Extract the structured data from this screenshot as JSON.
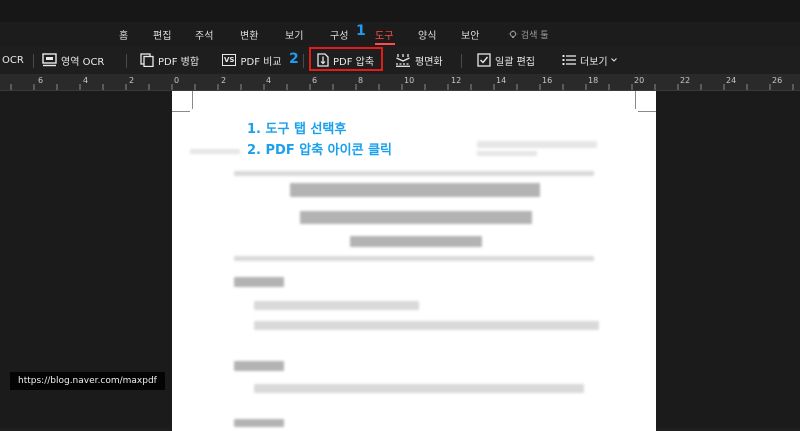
{
  "menu": {
    "tabs": [
      {
        "label": "홈"
      },
      {
        "label": "편집"
      },
      {
        "label": "주석"
      },
      {
        "label": "변환"
      },
      {
        "label": "보기"
      },
      {
        "label": "구성"
      },
      {
        "label": "도구",
        "active": true
      },
      {
        "label": "양식"
      },
      {
        "label": "보안"
      }
    ],
    "search_label": "검색 툴",
    "step1_badge": "1"
  },
  "toolbar": {
    "ocr_label": "OCR",
    "area_ocr_label": "영역 OCR",
    "merge_label": "PDF 병합",
    "compare_label": "PDF 비교",
    "compare_icon_text": "VS",
    "step2_badge": "2",
    "compress_label": "PDF 압축",
    "flatten_label": "평면화",
    "batch_label": "일괄 편집",
    "more_label": "더보기"
  },
  "ruler": {
    "labels": [
      "6",
      "4",
      "2",
      "0",
      "2",
      "4",
      "6",
      "8",
      "10",
      "12",
      "14",
      "16",
      "18",
      "20",
      "22",
      "24",
      "26"
    ]
  },
  "instructions": {
    "line1": "1. 도구 탭 선택후",
    "line2": "2. PDF 압축 아이콘 클릭"
  },
  "watermark": {
    "text": "https://blog.naver.com/maxpdf"
  },
  "colors": {
    "accent_red": "#ff4d4d",
    "highlight_border": "#e21b1b",
    "step_blue": "#1e9df0"
  }
}
